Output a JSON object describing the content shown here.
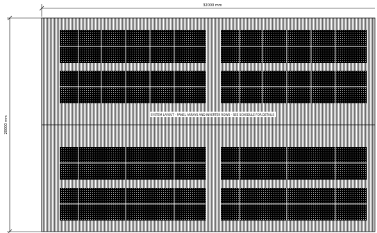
{
  "dimensions": {
    "width_label": "32000 mm",
    "height_label": "20000 mm"
  },
  "drawing": {
    "note": "SYSTEM LAYOUT - PANEL ARRAYS AND INVERTER ROWS - SEE SCHEDULE FOR DETAILS"
  },
  "colors": {
    "line": "#000000",
    "background": "#ffffff",
    "hatch": "#555555"
  }
}
